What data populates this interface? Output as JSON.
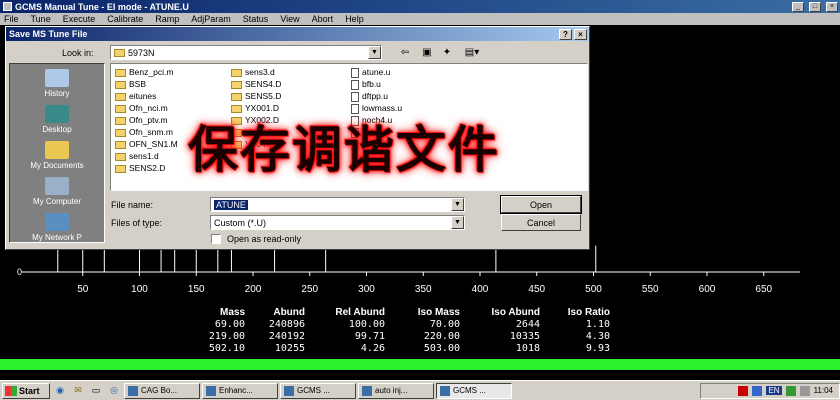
{
  "window": {
    "title": "GCMS Manual Tune - EI mode - ATUNE.U",
    "min": "_",
    "max": "□",
    "close": "×"
  },
  "menu": [
    "File",
    "Tune",
    "Execute",
    "Calibrate",
    "Ramp",
    "AdjParam",
    "Status",
    "View",
    "Abort",
    "Help"
  ],
  "dialog": {
    "title": "Save MS Tune File",
    "help": "?",
    "close": "×",
    "look_in_label": "Look in:",
    "look_in_value": "5973N",
    "places": [
      {
        "label": "History",
        "icon": "history-icon"
      },
      {
        "label": "Desktop",
        "icon": "desktop-icon"
      },
      {
        "label": "My Documents",
        "icon": "my-documents-icon"
      },
      {
        "label": "My Computer",
        "icon": "my-computer-icon"
      },
      {
        "label": "My Network P",
        "icon": "network-icon"
      }
    ],
    "files_col1": [
      "Benz_pci.m",
      "BSB",
      "eitunes",
      "Ofn_nci.m",
      "Ofn_ptv.m",
      "Ofn_snm.m",
      "OFN_SN1.M",
      "sens1.d",
      "SENS2.D"
    ],
    "files_col2": [
      "sens3.d",
      "SENS4.D",
      "SENS5.D",
      "YX001.D",
      "YX002.D",
      "YX03.D",
      "YX04.D"
    ],
    "files_col3": [
      "atune.u",
      "bfb.u",
      "dftpp.u",
      "lowmass.u",
      "noch4.u",
      "pci.u",
      "qtune.u"
    ],
    "filename_label": "File name:",
    "filename_value": "ATUNE",
    "filetype_label": "Files of type:",
    "filetype_value": "Custom (*.U)",
    "readonly_label": "Open as read-only",
    "open_button": "Open",
    "cancel_button": "Cancel"
  },
  "overlay_text": "保存调谐文件",
  "axis": {
    "zero": "0",
    "ticks": [
      "50",
      "100",
      "150",
      "200",
      "250",
      "300",
      "350",
      "400",
      "450",
      "500",
      "550",
      "600",
      "650"
    ]
  },
  "spectrum_peaks": [
    {
      "mass": 28,
      "h": 0.2
    },
    {
      "mass": 50,
      "h": 0.1
    },
    {
      "mass": 69,
      "h": 0.9
    },
    {
      "mass": 100,
      "h": 0.25
    },
    {
      "mass": 119,
      "h": 0.3
    },
    {
      "mass": 131,
      "h": 0.55
    },
    {
      "mass": 150,
      "h": 0.18
    },
    {
      "mass": 169,
      "h": 0.22
    },
    {
      "mass": 181,
      "h": 0.15
    },
    {
      "mass": 219,
      "h": 0.9
    },
    {
      "mass": 264,
      "h": 0.3
    },
    {
      "mass": 414,
      "h": 0.1
    },
    {
      "mass": 502,
      "h": 0.12
    }
  ],
  "results": {
    "headers": [
      "Mass",
      "Abund",
      "Rel Abund",
      "Iso Mass",
      "Iso Abund",
      "Iso Ratio"
    ],
    "rows": [
      [
        "69.00",
        "240896",
        "100.00",
        "70.00",
        "2644",
        "1.10"
      ],
      [
        "219.00",
        "240192",
        "99.71",
        "220.00",
        "10335",
        "4.30"
      ],
      [
        "502.10",
        "10255",
        "4.26",
        "503.00",
        "1018",
        "9.93"
      ]
    ]
  },
  "taskbar": {
    "start": "Start",
    "tasks": [
      "CAG Bo...",
      "Enhanc...",
      "GCMS ...",
      "auto inj...",
      "GCMS ..."
    ],
    "clock": "11:04",
    "lang": "EN"
  }
}
